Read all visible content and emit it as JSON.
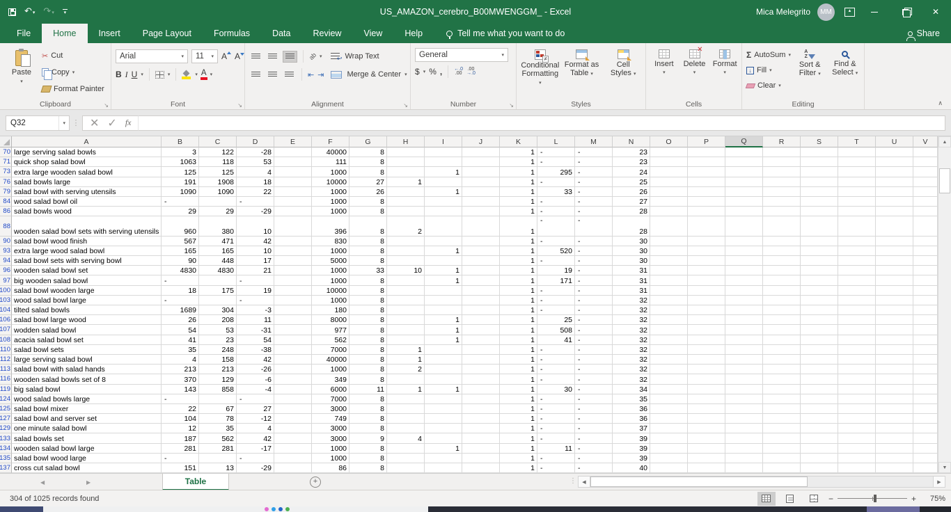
{
  "title_bar": {
    "title": "US_AMAZON_cerebro_B00MWENGGM_ - Excel",
    "user": "Mica Melegrito",
    "initials": "MM",
    "share": "Share",
    "tell_me": "Tell me what you want to do"
  },
  "ribbon_tabs": [
    {
      "label": "File",
      "active": false
    },
    {
      "label": "Home",
      "active": true
    },
    {
      "label": "Insert",
      "active": false
    },
    {
      "label": "Page Layout",
      "active": false
    },
    {
      "label": "Formulas",
      "active": false
    },
    {
      "label": "Data",
      "active": false
    },
    {
      "label": "Review",
      "active": false
    },
    {
      "label": "View",
      "active": false
    },
    {
      "label": "Help",
      "active": false
    }
  ],
  "ribbon": {
    "clipboard": {
      "label": "Clipboard",
      "paste": "Paste",
      "cut": "Cut",
      "copy": "Copy",
      "format_painter": "Format Painter"
    },
    "font": {
      "label": "Font",
      "family": "Arial",
      "size": "11",
      "bold": "B",
      "italic": "I",
      "underline": "U"
    },
    "alignment": {
      "label": "Alignment",
      "wrap": "Wrap Text",
      "merge": "Merge & Center"
    },
    "number": {
      "label": "Number",
      "format": "General",
      "dollar": "$",
      "percent": "%",
      "comma": ","
    },
    "styles": {
      "label": "Styles",
      "conditional_1": "Conditional",
      "conditional_2": "Formatting",
      "format_table_1": "Format as",
      "format_table_2": "Table",
      "cell_styles_1": "Cell",
      "cell_styles_2": "Styles"
    },
    "cells": {
      "label": "Cells",
      "insert": "Insert",
      "delete": "Delete",
      "format": "Format"
    },
    "editing": {
      "label": "Editing",
      "autosum": "AutoSum",
      "fill": "Fill",
      "clear": "Clear",
      "sort_1": "Sort &",
      "sort_2": "Filter",
      "find_1": "Find &",
      "find_2": "Select"
    }
  },
  "icons": {
    "undo": "↶",
    "redo": "↷",
    "dropdown": "▾",
    "scissors": "✂",
    "sigma": "Σ",
    "check": "✓",
    "cancel": "✕",
    "fx": "fx",
    "dots": "⋮",
    "left_arrow": "◀",
    "right_arrow": "▶",
    "up_arrow": "▲",
    "down_arrow": "▼",
    "collapse": "∧",
    "minus": "−",
    "plus": "+",
    "new_sheet": "+",
    "indent_dec": "⇤",
    "indent_inc": "⇥",
    "orient": "ab"
  },
  "formula_bar": {
    "name_box": "Q32",
    "formula": ""
  },
  "grid": {
    "columns": [
      "A",
      "B",
      "C",
      "D",
      "E",
      "F",
      "G",
      "H",
      "I",
      "J",
      "K",
      "L",
      "M",
      "N",
      "O",
      "P",
      "Q",
      "R",
      "S",
      "T",
      "U",
      "V"
    ],
    "selected_column": "Q",
    "rows": [
      {
        "num": "70",
        "cells": {
          "a": "large serving salad bowls",
          "b": "3",
          "c": "122",
          "d": "-28",
          "f": "40000",
          "g": "8",
          "k": "1",
          "l": "-",
          "m": "-",
          "n": "23"
        }
      },
      {
        "num": "71",
        "cells": {
          "a": "quick shop salad bowl",
          "b": "1063",
          "c": "118",
          "d": "53",
          "f": "111",
          "g": "8",
          "k": "1",
          "l": "-",
          "m": "-",
          "n": "23"
        }
      },
      {
        "num": "73",
        "cells": {
          "a": "extra large wooden salad bowl",
          "b": "125",
          "c": "125",
          "d": "4",
          "f": "1000",
          "g": "8",
          "i": "1",
          "k": "1",
          "l": "295",
          "m": "-",
          "n": "24"
        }
      },
      {
        "num": "76",
        "cells": {
          "a": "salad bowls large",
          "b": "191",
          "c": "1908",
          "d": "18",
          "f": "10000",
          "g": "27",
          "h": "1",
          "k": "1",
          "l": "-",
          "m": "-",
          "n": "25"
        }
      },
      {
        "num": "79",
        "cells": {
          "a": "salad bowl with serving utensils",
          "b": "1090",
          "c": "1090",
          "d": "22",
          "f": "1000",
          "g": "26",
          "i": "1",
          "k": "1",
          "l": "33",
          "m": "-",
          "n": "26"
        }
      },
      {
        "num": "84",
        "cells": {
          "a": "wood salad bowl oil",
          "b": "-",
          "d": "-",
          "f": "1000",
          "g": "8",
          "k": "1",
          "l": "-",
          "m": "-",
          "n": "27"
        }
      },
      {
        "num": "86",
        "cells": {
          "a": "salad bowls wood",
          "b": "29",
          "c": "29",
          "d": "-29",
          "f": "1000",
          "g": "8",
          "k": "1",
          "l": "-",
          "m": "-",
          "n": "28"
        }
      },
      {
        "num": "88",
        "tall": true,
        "cells": {
          "a": "wooden salad bowl sets with serving utensils",
          "b": "960",
          "c": "380",
          "d": "10",
          "f": "396",
          "g": "8",
          "h": "2",
          "k": "1",
          "l": "-",
          "m": "-",
          "n": "28"
        }
      },
      {
        "num": "90",
        "cells": {
          "a": "salad bowl wood finish",
          "b": "567",
          "c": "471",
          "d": "42",
          "f": "830",
          "g": "8",
          "k": "1",
          "l": "-",
          "m": "-",
          "n": "30"
        }
      },
      {
        "num": "93",
        "cells": {
          "a": "extra large wood salad bowl",
          "b": "165",
          "c": "165",
          "d": "10",
          "f": "1000",
          "g": "8",
          "i": "1",
          "k": "1",
          "l": "520",
          "m": "-",
          "n": "30"
        }
      },
      {
        "num": "94",
        "cells": {
          "a": "salad bowl sets with serving bowl",
          "b": "90",
          "c": "448",
          "d": "17",
          "f": "5000",
          "g": "8",
          "k": "1",
          "l": "-",
          "m": "-",
          "n": "30"
        }
      },
      {
        "num": "96",
        "cells": {
          "a": "wooden salad bowl set",
          "b": "4830",
          "c": "4830",
          "d": "21",
          "f": "1000",
          "g": "33",
          "h": "10",
          "i": "1",
          "k": "1",
          "l": "19",
          "m": "-",
          "n": "31"
        }
      },
      {
        "num": "97",
        "cells": {
          "a": "big wooden salad bowl",
          "b": "-",
          "d": "-",
          "f": "1000",
          "g": "8",
          "i": "1",
          "k": "1",
          "l": "171",
          "m": "-",
          "n": "31"
        }
      },
      {
        "num": "100",
        "cells": {
          "a": "salad bowl wooden large",
          "b": "18",
          "c": "175",
          "d": "19",
          "f": "10000",
          "g": "8",
          "k": "1",
          "l": "-",
          "m": "-",
          "n": "31"
        }
      },
      {
        "num": "103",
        "cells": {
          "a": "wood salad bowl large",
          "b": "-",
          "d": "-",
          "f": "1000",
          "g": "8",
          "k": "1",
          "l": "-",
          "m": "-",
          "n": "32"
        }
      },
      {
        "num": "104",
        "cells": {
          "a": "tilted salad bowls",
          "b": "1689",
          "c": "304",
          "d": "-3",
          "f": "180",
          "g": "8",
          "k": "1",
          "l": "-",
          "m": "-",
          "n": "32"
        }
      },
      {
        "num": "106",
        "cells": {
          "a": "salad bowl large wood",
          "b": "26",
          "c": "208",
          "d": "11",
          "f": "8000",
          "g": "8",
          "i": "1",
          "k": "1",
          "l": "25",
          "m": "-",
          "n": "32"
        }
      },
      {
        "num": "107",
        "cells": {
          "a": "wodden salad bowl",
          "b": "54",
          "c": "53",
          "d": "-31",
          "f": "977",
          "g": "8",
          "i": "1",
          "k": "1",
          "l": "508",
          "m": "-",
          "n": "32"
        }
      },
      {
        "num": "108",
        "cells": {
          "a": "acacia salad bowl set",
          "b": "41",
          "c": "23",
          "d": "54",
          "f": "562",
          "g": "8",
          "i": "1",
          "k": "1",
          "l": "41",
          "m": "-",
          "n": "32"
        }
      },
      {
        "num": "110",
        "cells": {
          "a": "salad bowl sets",
          "b": "35",
          "c": "248",
          "d": "-38",
          "f": "7000",
          "g": "8",
          "h": "1",
          "k": "1",
          "l": "-",
          "m": "-",
          "n": "32"
        }
      },
      {
        "num": "112",
        "cells": {
          "a": "large serving salad bowl",
          "b": "4",
          "c": "158",
          "d": "42",
          "f": "40000",
          "g": "8",
          "h": "1",
          "k": "1",
          "l": "-",
          "m": "-",
          "n": "32"
        }
      },
      {
        "num": "113",
        "cells": {
          "a": "salad bowl with salad hands",
          "b": "213",
          "c": "213",
          "d": "-26",
          "f": "1000",
          "g": "8",
          "h": "2",
          "k": "1",
          "l": "-",
          "m": "-",
          "n": "32"
        }
      },
      {
        "num": "116",
        "cells": {
          "a": "wooden salad bowls set of 8",
          "b": "370",
          "c": "129",
          "d": "-6",
          "f": "349",
          "g": "8",
          "k": "1",
          "l": "-",
          "m": "-",
          "n": "32"
        }
      },
      {
        "num": "119",
        "cells": {
          "a": "big salad bowl",
          "b": "143",
          "c": "858",
          "d": "-4",
          "f": "6000",
          "g": "11",
          "h": "1",
          "i": "1",
          "k": "1",
          "l": "30",
          "m": "-",
          "n": "34"
        }
      },
      {
        "num": "124",
        "cells": {
          "a": "wood salad bowls large",
          "b": "-",
          "d": "-",
          "f": "7000",
          "g": "8",
          "k": "1",
          "l": "-",
          "m": "-",
          "n": "35"
        }
      },
      {
        "num": "125",
        "cells": {
          "a": "salad bowl mixer",
          "b": "22",
          "c": "67",
          "d": "27",
          "f": "3000",
          "g": "8",
          "k": "1",
          "l": "-",
          "m": "-",
          "n": "36"
        }
      },
      {
        "num": "127",
        "cells": {
          "a": "salad bowl and server set",
          "b": "104",
          "c": "78",
          "d": "-12",
          "f": "749",
          "g": "8",
          "k": "1",
          "l": "-",
          "m": "-",
          "n": "36"
        }
      },
      {
        "num": "129",
        "cells": {
          "a": "one minute salad bowl",
          "b": "12",
          "c": "35",
          "d": "4",
          "f": "3000",
          "g": "8",
          "k": "1",
          "l": "-",
          "m": "-",
          "n": "37"
        }
      },
      {
        "num": "133",
        "cells": {
          "a": "salad bowls set",
          "b": "187",
          "c": "562",
          "d": "42",
          "f": "3000",
          "g": "9",
          "h": "4",
          "k": "1",
          "l": "-",
          "m": "-",
          "n": "39"
        }
      },
      {
        "num": "134",
        "cells": {
          "a": "wooden salad bowl large",
          "b": "281",
          "c": "281",
          "d": "-17",
          "f": "1000",
          "g": "8",
          "i": "1",
          "k": "1",
          "l": "11",
          "m": "-",
          "n": "39"
        }
      },
      {
        "num": "135",
        "cells": {
          "a": "salad bowl wood large",
          "b": "-",
          "d": "-",
          "f": "1000",
          "g": "8",
          "k": "1",
          "l": "-",
          "m": "-",
          "n": "39"
        }
      },
      {
        "num": "137",
        "cells": {
          "a": "cross cut salad bowl",
          "b": "151",
          "c": "13",
          "d": "-29",
          "f": "86",
          "g": "8",
          "k": "1",
          "l": "-",
          "m": "-",
          "n": "40"
        }
      }
    ]
  },
  "sheet": {
    "active_tab": "Table"
  },
  "status": {
    "records": "304 of 1025 records found",
    "zoom": "75%"
  },
  "colors": {
    "brand_green": "#217346",
    "accent_green": "#1e7145",
    "filtered_row_blue": "#2049c7",
    "font_color_red": "#e81123",
    "fill_yellow": "#ffe400"
  }
}
